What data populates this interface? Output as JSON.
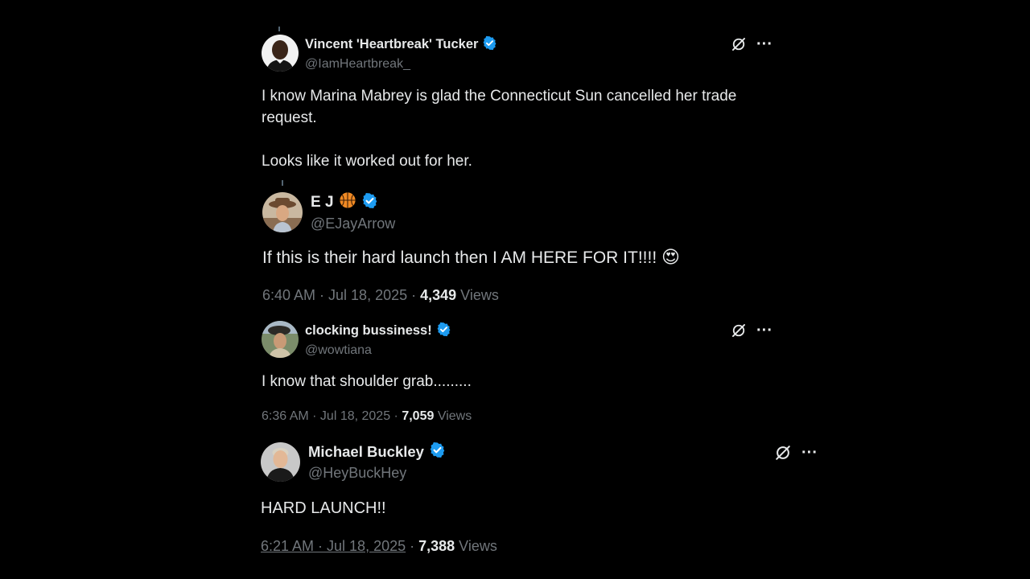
{
  "tweets": [
    {
      "display_name": "Vincent 'Heartbreak' Tucker",
      "handle": "@IamHeartbreak_",
      "text": "I know Marina Mabrey is glad the Connecticut Sun cancelled her trade\nrequest.\n\nLooks like it worked out for her.",
      "icons": [
        "grok-icon",
        "more-icon"
      ]
    },
    {
      "display_name": "E J",
      "handle": "@EJayArrow",
      "text": "If this is their hard launch then I AM HERE FOR IT!!!!",
      "emoji": "😍",
      "timestamp": "6:40 AM · Jul 18, 2025",
      "separator": " · ",
      "views_count": "4,349",
      "views_label": " Views"
    },
    {
      "display_name": "clocking bussiness!",
      "handle": "@wowtiana",
      "text": "I know that shoulder grab.........",
      "timestamp": "6:36 AM · Jul 18, 2025",
      "separator": " · ",
      "views_count": "7,059",
      "views_label": " Views",
      "icons": [
        "grok-icon",
        "more-icon"
      ]
    },
    {
      "display_name": "Michael Buckley",
      "handle": "@HeyBuckHey",
      "text": "HARD LAUNCH!!",
      "timestamp": "6:21 AM · Jul 18, 2025",
      "separator": " · ",
      "views_count": "7,388",
      "views_label": " Views",
      "icons": [
        "grok-icon",
        "more-icon"
      ]
    }
  ],
  "colors": {
    "background": "#000000",
    "text_primary": "#e7e9ea",
    "text_secondary": "#71767b",
    "verified_blue": "#1d9bf0",
    "basketball_orange": "#f08a24"
  }
}
